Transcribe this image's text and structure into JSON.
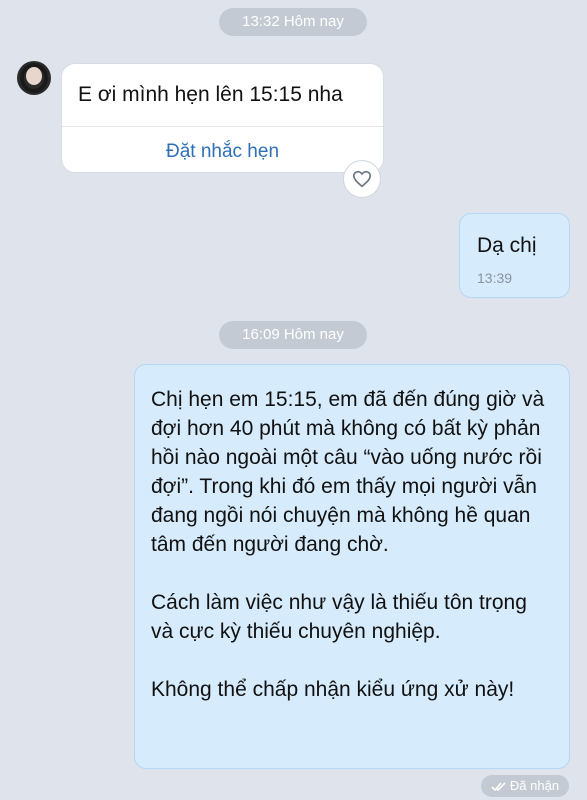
{
  "timestamps": {
    "first": "13:32 Hôm nay",
    "second": "16:09 Hôm nay"
  },
  "incoming_message": {
    "text": "E ơi mình hẹn lên 15:15 nha",
    "action": "Đặt nhắc hẹn"
  },
  "reply_message": {
    "text": "Dạ chị",
    "time": "13:39"
  },
  "long_message": {
    "paragraph1": "Chị hẹn em 15:15, em đã đến đúng giờ và đợi hơn 40 phút mà không có bất kỳ phản hồi nào ngoài một câu “vào uống nước rồi đợi”. Trong khi đó em thấy mọi người vẫn đang ngồi nói chuyện mà không hề quan tâm đến người đang chờ.",
    "paragraph2": "Cách làm việc như vậy là thiếu tôn trọng và cực kỳ thiếu chuyên nghiệp.",
    "paragraph3": "Không thể chấp nhận kiểu ứng xử này!"
  },
  "status": {
    "text": "Đã nhận",
    "icon": "double-check-icon"
  },
  "colors": {
    "background": "#dfe4ec",
    "outgoing_bubble": "#d6ebfb",
    "link": "#2f6fb5"
  }
}
